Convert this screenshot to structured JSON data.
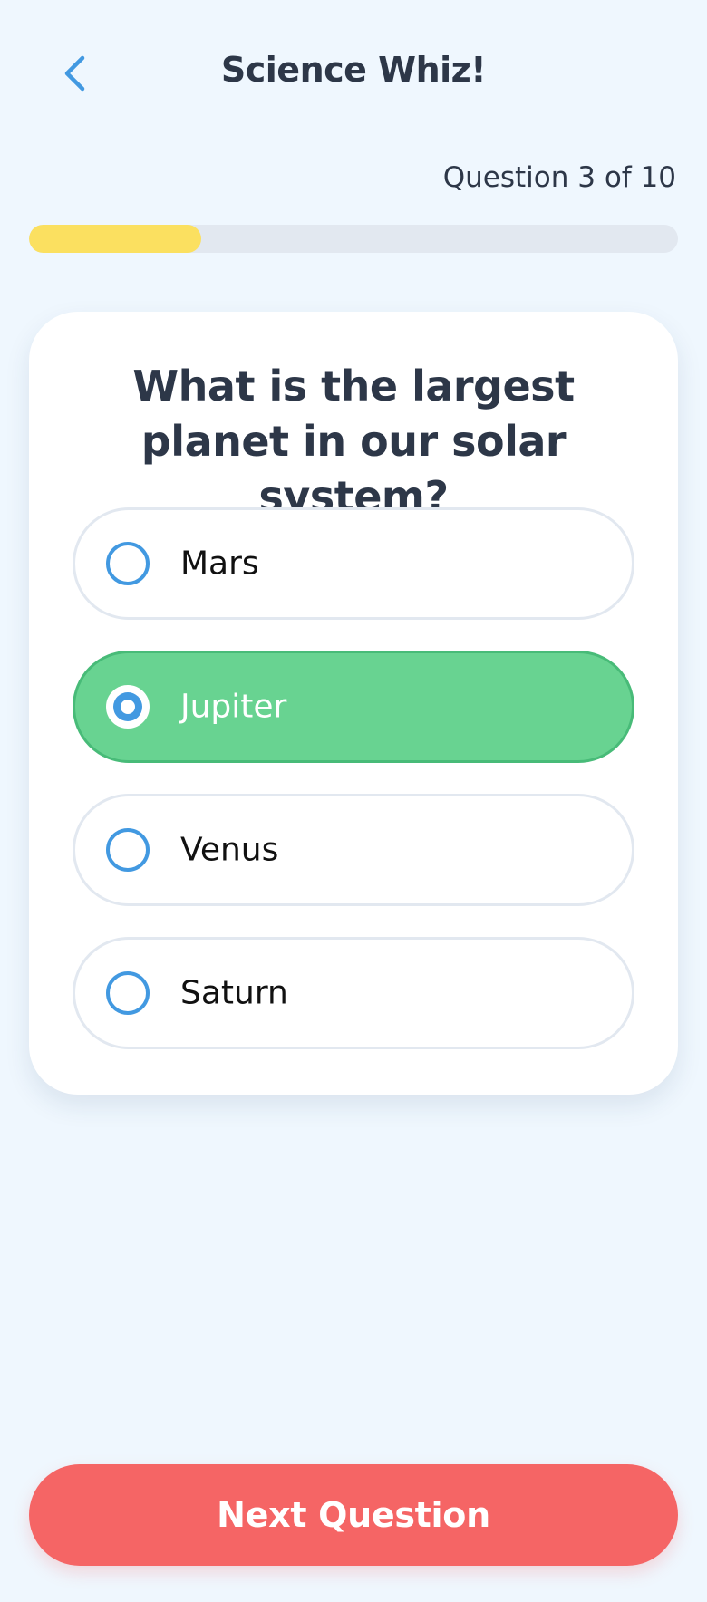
{
  "header": {
    "title": "Science Whiz!",
    "back_icon": "chevron-left-icon"
  },
  "progress": {
    "label": "Question 3 of 10",
    "current": 3,
    "total": 10,
    "fraction": 0.265,
    "fill_color": "#FBE060"
  },
  "question": {
    "text": "What is the largest planet in our solar system?"
  },
  "options": [
    {
      "label": "Mars",
      "selected": false
    },
    {
      "label": "Jupiter",
      "selected": true
    },
    {
      "label": "Venus",
      "selected": false
    },
    {
      "label": "Saturn",
      "selected": false
    }
  ],
  "footer": {
    "next_label": "Next Question"
  },
  "colors": {
    "background": "#EFF7FE",
    "accent_blue": "#4299E1",
    "selected_green": "#68D391",
    "button_red": "#F56565"
  }
}
